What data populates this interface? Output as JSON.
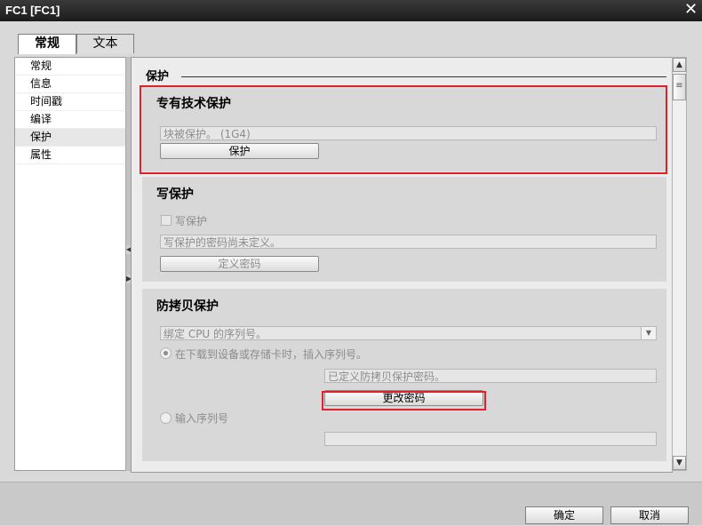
{
  "window": {
    "title": "FC1 [FC1]"
  },
  "tabs": [
    {
      "label": "常规"
    },
    {
      "label": "文本"
    }
  ],
  "nav": {
    "items": [
      {
        "label": "常规"
      },
      {
        "label": "信息"
      },
      {
        "label": "时间戳"
      },
      {
        "label": "编译"
      },
      {
        "label": "保护"
      },
      {
        "label": "属性"
      }
    ],
    "selected": "保护"
  },
  "content": {
    "heading": "保护",
    "know_how": {
      "title": "专有技术保护",
      "status": "块被保护。 (1G4)",
      "button": "保护"
    },
    "write": {
      "title": "写保护",
      "checkbox_label": "写保护",
      "status": "写保护的密码尚未定义。",
      "button": "定义密码"
    },
    "copy": {
      "title": "防拷贝保护",
      "select_value": "绑定 CPU 的序列号。",
      "radio1_label": "在下载到设备或存储卡时，插入序列号。",
      "password_status": "已定义防拷贝保护密码。",
      "change_button": "更改密码",
      "radio2_label": "输入序列号",
      "serial_value": ""
    }
  },
  "footer": {
    "ok": "确定",
    "cancel": "取消"
  },
  "colors": {
    "highlight": "#e0202a",
    "titlebar": "#2a2a2a"
  }
}
